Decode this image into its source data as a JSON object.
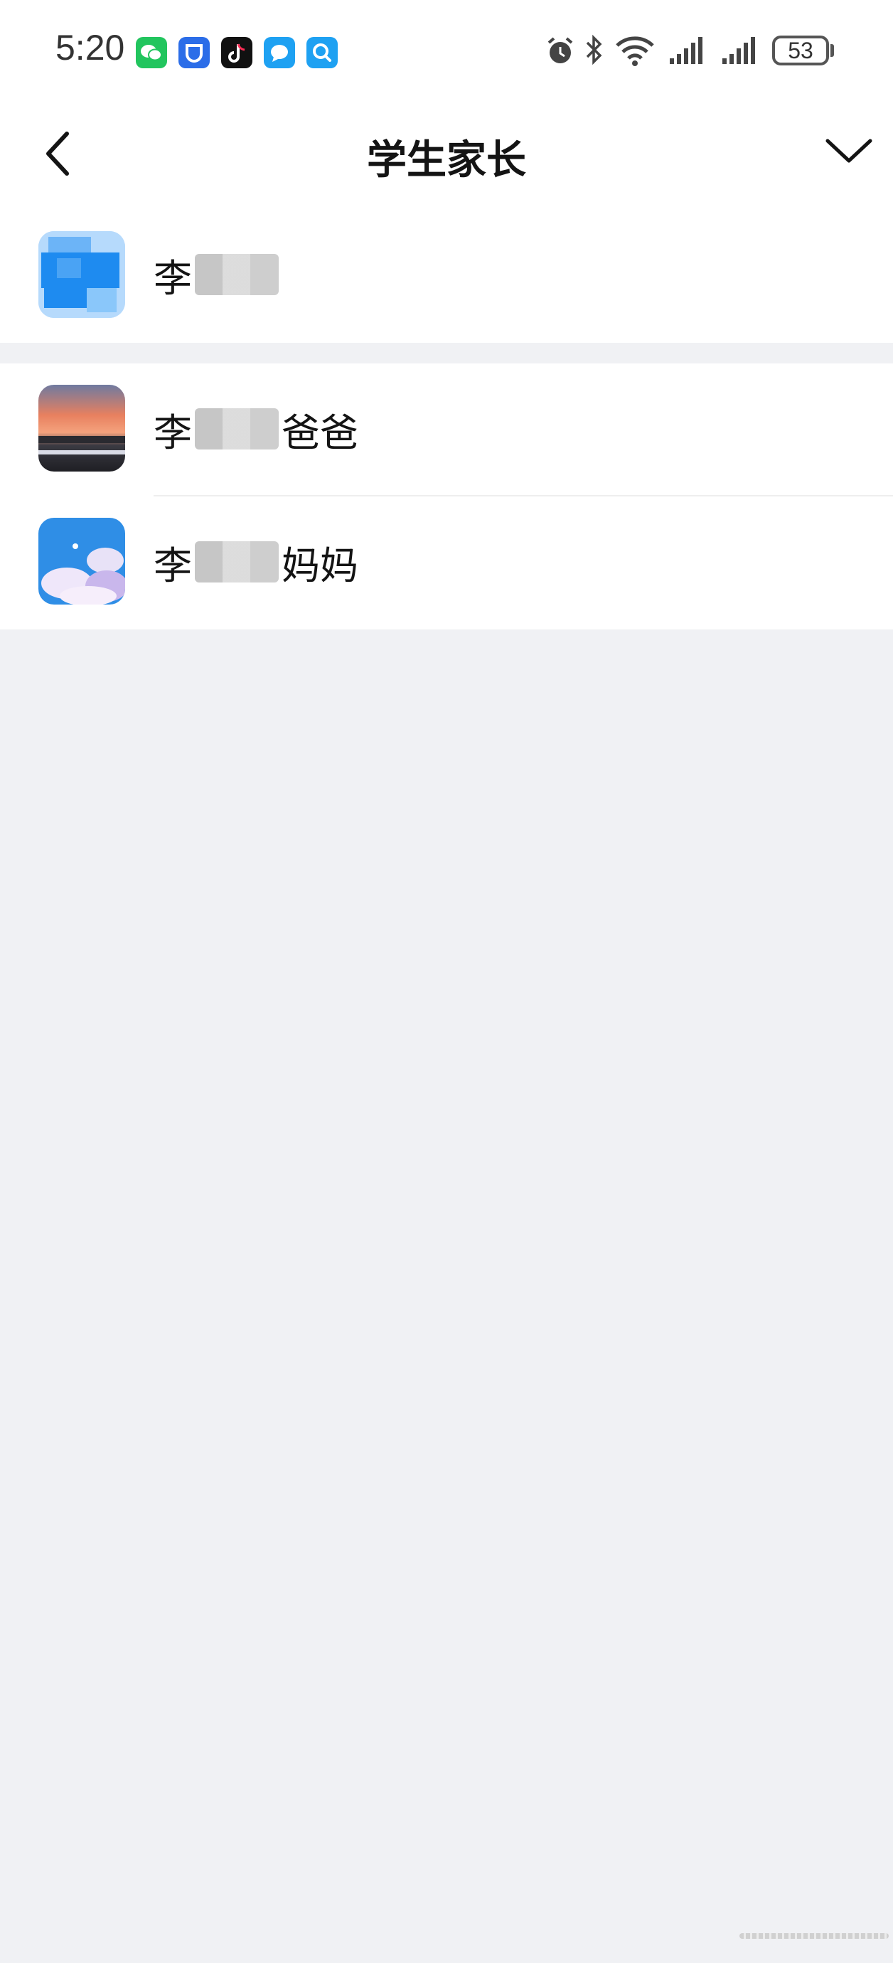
{
  "status_bar": {
    "time": "5:20",
    "battery": "53",
    "apps": [
      "wechat-icon",
      "app-shield-icon",
      "tiktok-icon",
      "chat-bubble-icon",
      "search-app-icon"
    ]
  },
  "header": {
    "title": "学生家长"
  },
  "contacts": [
    {
      "name_prefix": "李",
      "name_suffix": ""
    },
    {
      "name_prefix": "李",
      "name_suffix": "爸爸"
    },
    {
      "name_prefix": "李",
      "name_suffix": "妈妈"
    }
  ],
  "colors": {
    "page_bg": "#f0f1f4",
    "card_bg": "#ffffff",
    "text": "#141414"
  }
}
